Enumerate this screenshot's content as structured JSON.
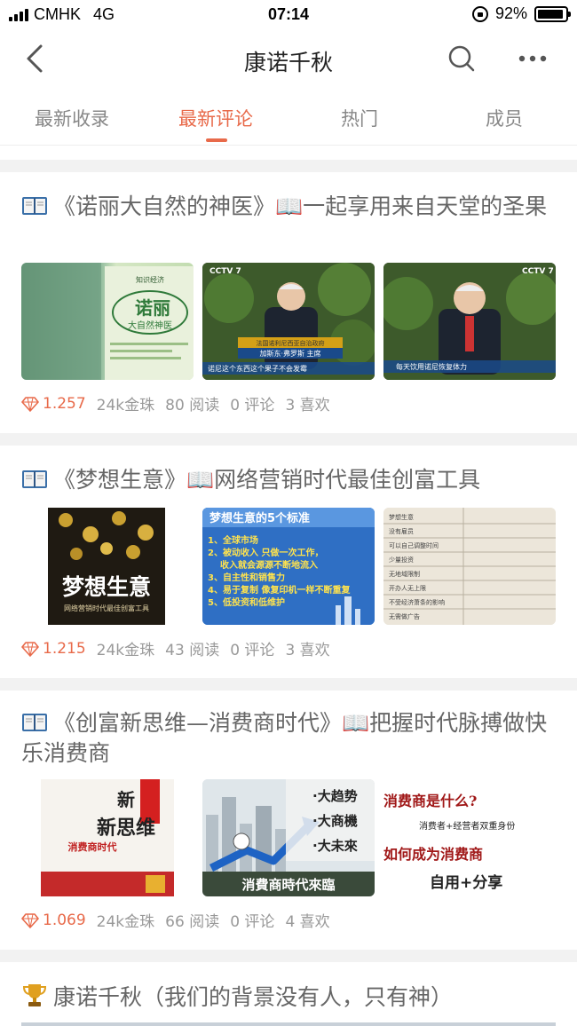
{
  "status_bar": {
    "carrier": "CMHK",
    "network": "4G",
    "time": "07:14",
    "battery": "92%",
    "battery_level": 0.92
  },
  "nav": {
    "title": "康诺千秋",
    "back_icon": "chevron-left-icon",
    "search_icon": "search-icon",
    "more_icon": "more-dots-icon"
  },
  "tabs": [
    {
      "label": "最新收录"
    },
    {
      "label": "最新评论"
    },
    {
      "label": "热门"
    },
    {
      "label": "成员"
    }
  ],
  "active_tab": 1,
  "accent_color": "#e86a4a",
  "posts": [
    {
      "title": "《诺丽大自然的神医》📖一起享用来自天堂的圣果",
      "score": "1.257",
      "coins": "24k金珠",
      "reads": "80 阅读",
      "comments": "0 评论",
      "likes": "3 喜欢",
      "images": [
        {
          "cover_title": "诺丽",
          "cover_subtitle": "大自然神医",
          "cover_top": "知识经济"
        },
        {
          "caption": "诺尼这个东西这个果子不会发霉",
          "lower_third": "法国诺利尼西亚自治政府",
          "name_tag": "加斯东·弗罗斯 主席",
          "channel": "CCTV 7"
        },
        {
          "caption": "每天饮用诺尼恢复体力",
          "channel": "CCTV 7"
        }
      ]
    },
    {
      "title": "《梦想生意》📖网络营销时代最佳创富工具",
      "score": "1.215",
      "coins": "24k金珠",
      "reads": "43 阅读",
      "comments": "0 评论",
      "likes": "3 喜欢",
      "images": [
        {
          "cover_title": "梦想生意",
          "cover_subtitle": "网络营销时代最佳创富工具"
        },
        {
          "slide_title": "梦想生意的5个标准",
          "lines": [
            "1、全球市场",
            "2、被动收入 只做一次工作，",
            "收入就会源源不断地流入",
            "3、自主性和销售力",
            "4、易于复制 像复印机一样不断重复",
            "5、低投资和低维护"
          ]
        },
        {
          "doc_rows": [
            "梦想生意",
            "没有雇员",
            "可以自己调整时间",
            "少量投资",
            "无地域限制",
            "开办人无上限",
            "不受经济萧条的影响",
            "无需做广告"
          ]
        }
      ]
    },
    {
      "title": "《创富新思维—消费商时代》📖把握时代脉搏做快乐消费商",
      "score": "1.069",
      "coins": "24k金珠",
      "reads": "66 阅读",
      "comments": "0 评论",
      "likes": "4 喜欢",
      "images": [
        {
          "cover_title": "新思维",
          "cover_subtitle": "消费商时代"
        },
        {
          "lines": [
            "·大趋势",
            "·大商機",
            "·大未來"
          ],
          "banner": "消費商時代來臨"
        },
        {
          "q": "消费商是什么?",
          "a": "消费者+经营者双重身份",
          "q2": "如何成为消费商",
          "a2": "自用+分享"
        }
      ]
    },
    {
      "title": "康诺千秋（我们的背景没有人，只有神）"
    }
  ]
}
